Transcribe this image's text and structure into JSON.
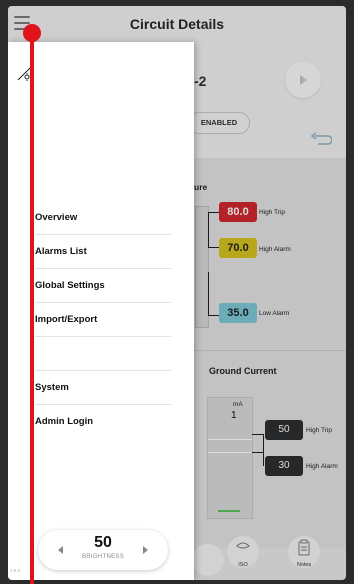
{
  "header": {
    "title": "Circuit Details"
  },
  "circuit": {
    "name_partial": "-2",
    "status": "ENABLED"
  },
  "temperature": {
    "title_partial": "ure",
    "high_trip": {
      "value": "80.0",
      "label": "High Trip",
      "color": "#d1282e"
    },
    "high_alarm": {
      "value": "70.0",
      "label": "High Alarm",
      "color": "#d8c320"
    },
    "low_alarm": {
      "value": "35.0",
      "label": "Low Alarm",
      "color": "#7ec9d8"
    }
  },
  "ground_current": {
    "title": "Ground Current",
    "unit": "mA",
    "value": "1",
    "high_trip": {
      "value": "50",
      "label": "High Trip"
    },
    "high_alarm": {
      "value": "30",
      "label": "High Alarm"
    }
  },
  "bottom_buttons": {
    "iso_label": "ISO",
    "notes_label": "Notes"
  },
  "drawer": {
    "menu": {
      "overview": "Overview",
      "alarms": "Alarms List",
      "global": "Global Settings",
      "import_export": "Import/Export",
      "system": "System",
      "admin": "Admin Login"
    },
    "brightness": {
      "value": "50",
      "label": "BRIGHTNESS"
    },
    "version": "1.8.3"
  },
  "colors": {
    "overlay_accent": "#e0121c",
    "header_bg": "#cfcfcf"
  }
}
